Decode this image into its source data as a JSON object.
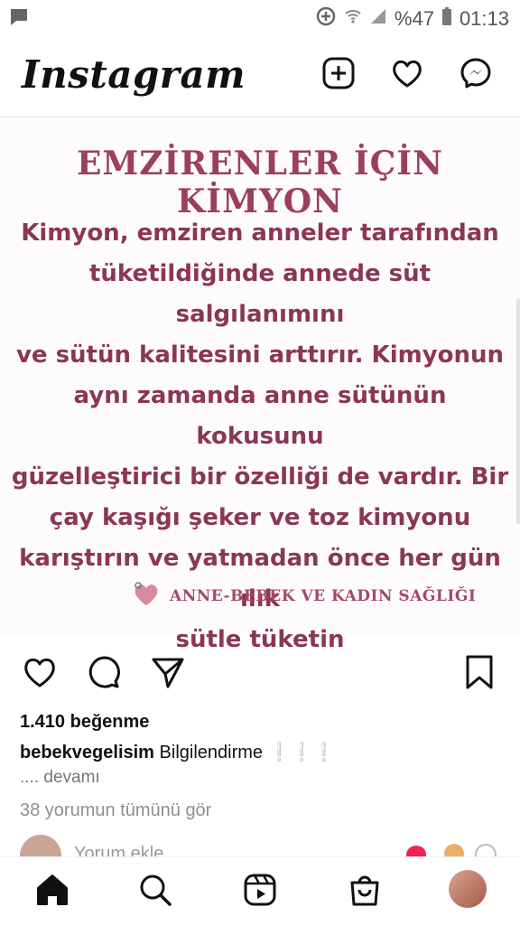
{
  "status_bar": {
    "battery_percent": "%47",
    "time": "01:13",
    "icons": [
      "message-icon",
      "data-saver-icon",
      "wifi-icon",
      "signal-icon",
      "battery-icon"
    ]
  },
  "header": {
    "logo": "Instagram",
    "icons": [
      "new-post-icon",
      "activity-heart-icon",
      "messenger-icon"
    ]
  },
  "post": {
    "image": {
      "title": "EMZİRENLER İÇİN KİMYON",
      "body_lines": [
        "Kimyon, emziren anneler tarafından",
        "tüketildiğinde annede süt salgılanımını",
        "ve sütün kalitesini arttırır. Kimyonun",
        "aynı zamanda anne sütünün kokusunu",
        "güzelleştirici bir özelliği de vardır. Bir",
        "çay kaşığı şeker ve toz kimyonu",
        "karıştırın ve yatmadan önce her gün ılık",
        "sütle tüketin"
      ],
      "brand": "ANNE-BEBEK VE KADIN SAĞLIĞI"
    },
    "likes": "1.410 beğenme",
    "caption": {
      "username": "bebekvegelisim",
      "text": "Bilgilendirme ❕❕❕"
    },
    "more_label": ".... devamı",
    "view_comments": "38 yorumun tümünü gör",
    "comment_placeholder": "Yorum ekle..."
  },
  "colors": {
    "title": "#9c3f5b",
    "body": "#8b3655",
    "brand": "#a64868"
  },
  "bottom_nav": [
    "home-icon",
    "search-icon",
    "reels-icon",
    "shop-icon",
    "profile-avatar"
  ]
}
